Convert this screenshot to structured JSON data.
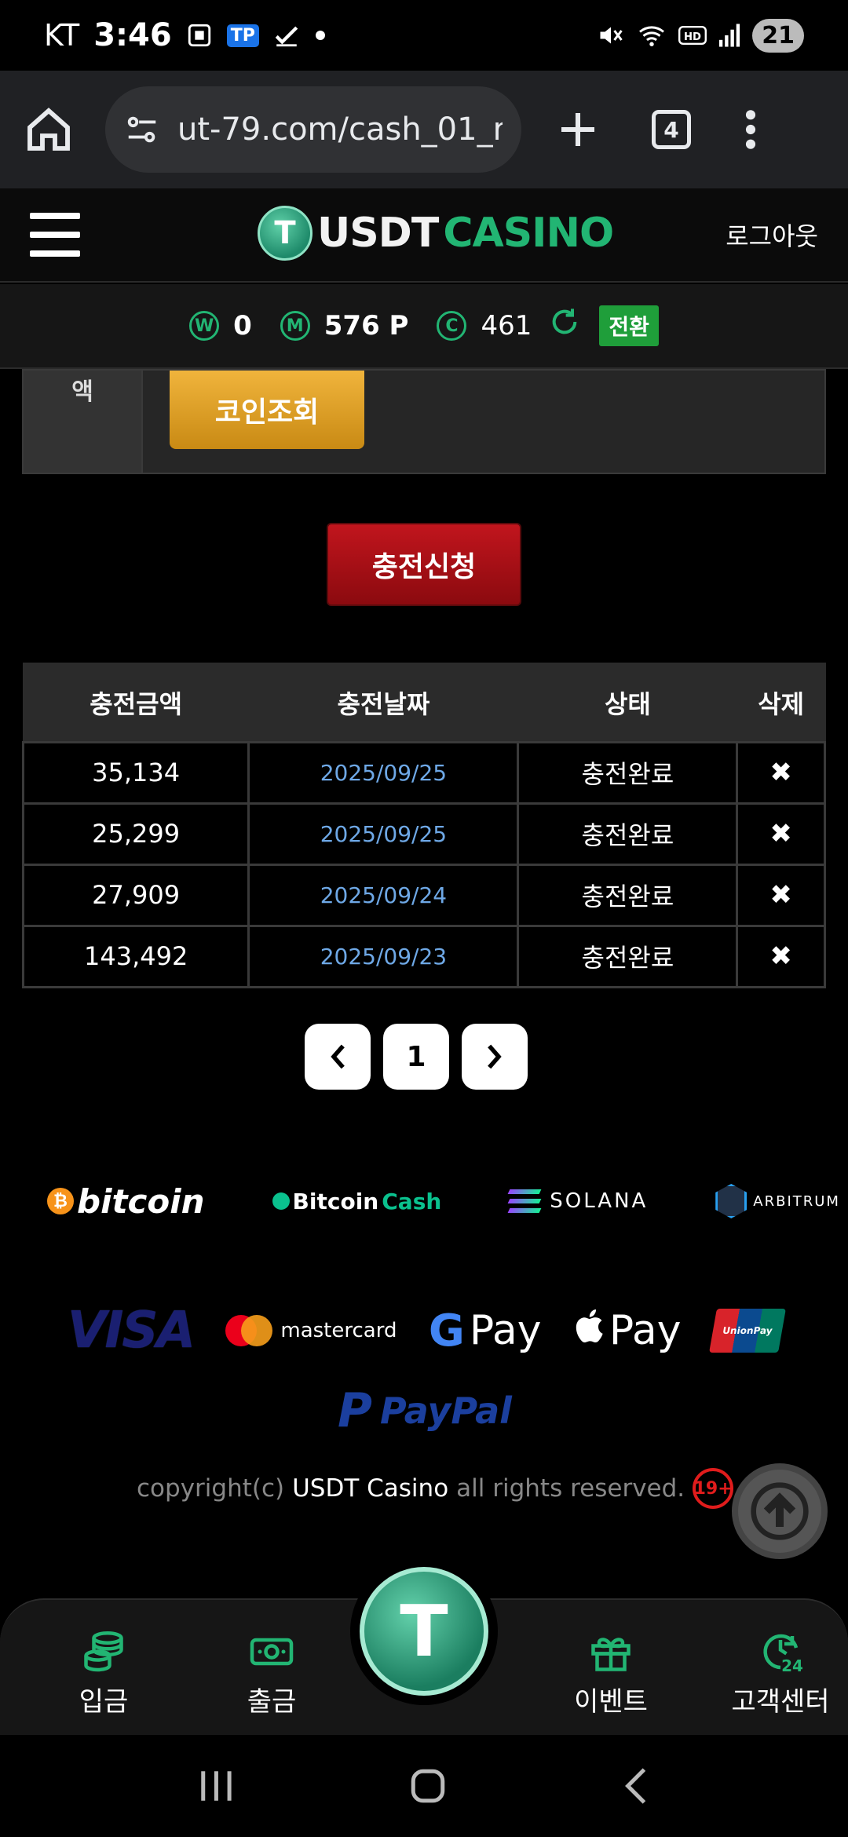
{
  "status_bar": {
    "carrier": "KT",
    "time": "3:46",
    "tp_badge": "TP",
    "battery": "21",
    "icons": [
      "screenshot-icon",
      "tp-app-icon",
      "check-icon",
      "dot-icon",
      "mute-icon",
      "wifi-icon",
      "hd-icon",
      "signal-icon",
      "battery-icon"
    ]
  },
  "browser": {
    "url": "ut-79.com/cash_01_r",
    "tabs_count": "4",
    "icons": [
      "home-icon",
      "site-settings-icon",
      "plus-icon",
      "tabs-icon",
      "more-icon"
    ]
  },
  "header": {
    "logo_coin": "T",
    "logo_usdt": "USDT",
    "logo_casino": "CASINO",
    "logout": "로그아웃"
  },
  "points": {
    "w_symbol": "W",
    "w_value": "0",
    "m_symbol": "M",
    "m_value": "576 P",
    "c_symbol": "C",
    "c_value": "461",
    "switch_label": "전환"
  },
  "form": {
    "row_label": "액",
    "coin_button": "코인조회"
  },
  "charge_button": "충전신청",
  "history": {
    "headers": [
      "충전금액",
      "충전날짜",
      "상태",
      "삭제"
    ],
    "rows": [
      {
        "amount": "35,134",
        "date": "2025/09/25",
        "status": "충전완료",
        "delete": "✖"
      },
      {
        "amount": "25,299",
        "date": "2025/09/25",
        "status": "충전완료",
        "delete": "✖"
      },
      {
        "amount": "27,909",
        "date": "2025/09/24",
        "status": "충전완료",
        "delete": "✖"
      },
      {
        "amount": "143,492",
        "date": "2025/09/23",
        "status": "충전완료",
        "delete": "✖"
      }
    ]
  },
  "pagination": {
    "prev": "‹",
    "current": "1",
    "next": "›"
  },
  "payment_logos": {
    "bitcoin": "bitcoin",
    "bitcoin_cash_a": "Bitcoin",
    "bitcoin_cash_b": "Cash",
    "solana": "SOLANA",
    "arbitrum": "ARBITRUM",
    "visa": "VISA",
    "mastercard": "mastercard",
    "gpay": "Pay",
    "applepay": "Pay",
    "unionpay": "UnionPay",
    "paypal": "PayPal"
  },
  "footer": {
    "copyright_prefix": "copyright(c)",
    "copyright_brand": "USDT Casino",
    "copyright_suffix": "all rights reserved.",
    "age_badge": "19+"
  },
  "bottom_nav": {
    "items": [
      {
        "label": "입금",
        "icon": "coins-icon"
      },
      {
        "label": "출금",
        "icon": "cash-icon"
      },
      {
        "label": "이벤트",
        "icon": "gift-icon"
      },
      {
        "label": "고객센터",
        "icon": "support-24-icon"
      }
    ],
    "center_coin": "T"
  },
  "colors": {
    "accent_green": "#22b573",
    "charge_red": "#c1151d",
    "coin_gold": "#f0b43c",
    "date_blue": "#6ea8e6"
  }
}
